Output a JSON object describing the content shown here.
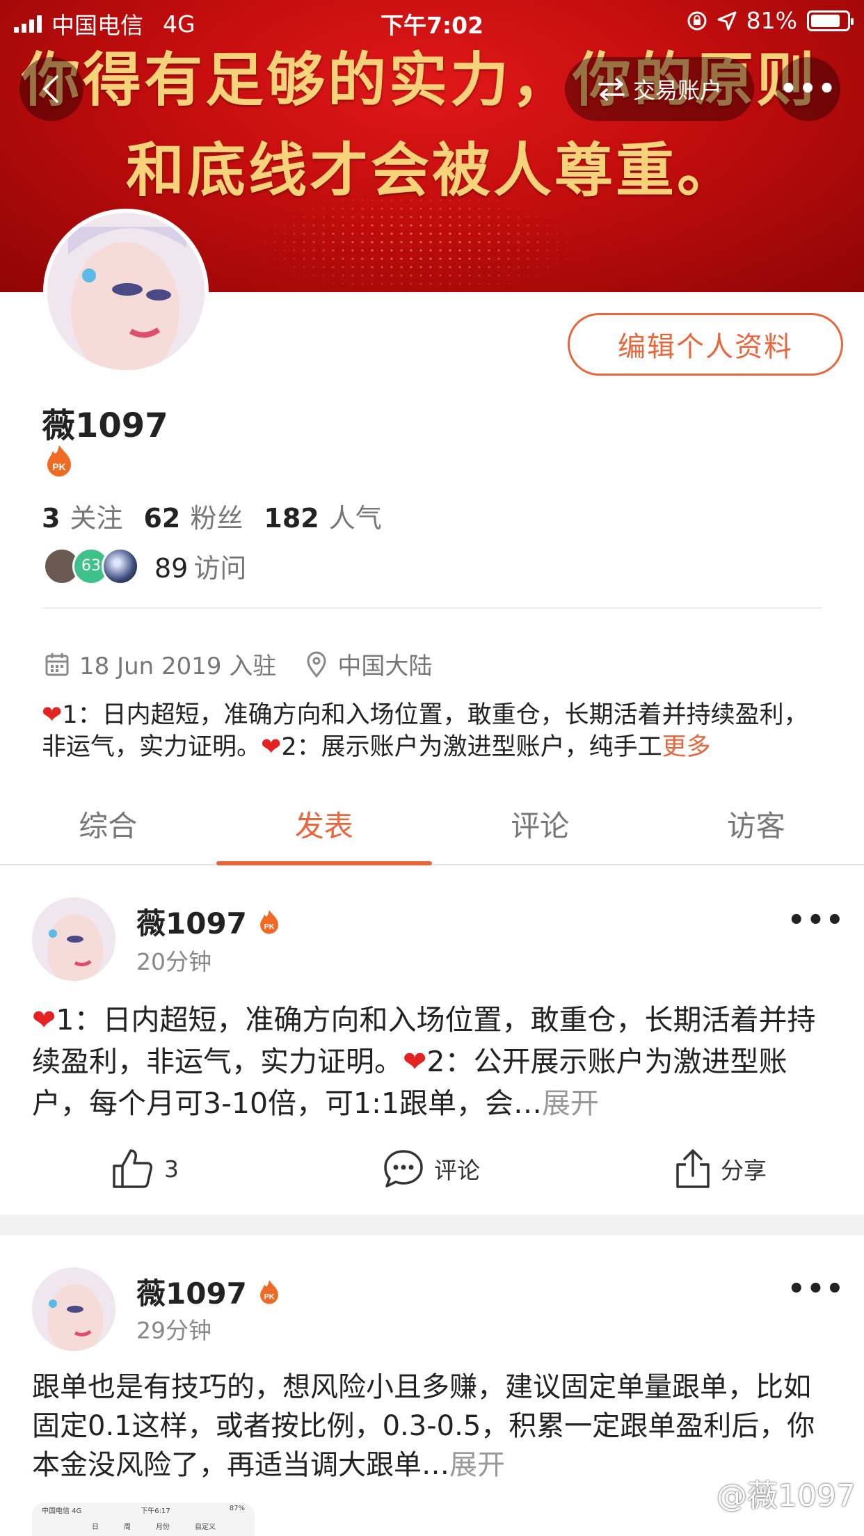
{
  "status_bar": {
    "carrier": "中国电信",
    "network": "4G",
    "time": "下午7:02",
    "battery": "81%",
    "battery_level": 0.81
  },
  "banner": {
    "line1": "你得有足够的实力，你的原则",
    "line2": "和底线才会被人尊重。"
  },
  "nav": {
    "trade_account": "交易账户",
    "more": "•••"
  },
  "profile": {
    "name": "薇1097",
    "edit_label": "编辑个人资料",
    "following_count": "3",
    "following_label": "关注",
    "fans_count": "62",
    "fans_label": "粉丝",
    "popularity_count": "182",
    "popularity_label": "人气",
    "visitor_avatar_badge": "63",
    "visits_count": "89",
    "visits_label": "访问",
    "joined": "18 Jun 2019 入驻",
    "location": "中国大陆",
    "bio_part1": "1：日内超短，准确方向和入场位置，敢重仓，长期活着并持续盈利，非运气，实力证明。",
    "bio_part2": "2：展示账户为激进型账户，纯手工",
    "bio_more": "更多"
  },
  "tabs": [
    "综合",
    "发表",
    "评论",
    "访客"
  ],
  "posts": [
    {
      "name": "薇1097",
      "time": "20分钟",
      "text_part1": "1：日内超短，准确方向和入场位置，敢重仓，长期活着并持续盈利，非运气，实力证明。",
      "text_part2": "2：公开展示账户为激进型账户，每个月可3-10倍，可1:1跟单，会…",
      "expand": "展开",
      "likes": "3",
      "comment_label": "评论",
      "share_label": "分享"
    },
    {
      "name": "薇1097",
      "time": "29分钟",
      "text": "跟单也是有技巧的，想风险小且多赚，建议固定单量跟单，比如固定0.1这样，或者按比例，0.3-0.5，积累一定跟单盈利后，你本金没风险了，再适当调大跟单…",
      "expand": "展开",
      "thumb_carrier": "中国电信 4G",
      "thumb_time": "下午6:17",
      "thumb_battery": "87%",
      "thumb_segments": [
        "日",
        "周",
        "月份",
        "自定义"
      ]
    }
  ],
  "watermark": "@薇1097",
  "colors": {
    "accent": "#e8663b",
    "banner_red": "#c20d0d",
    "banner_gold": "#f6d27a"
  }
}
